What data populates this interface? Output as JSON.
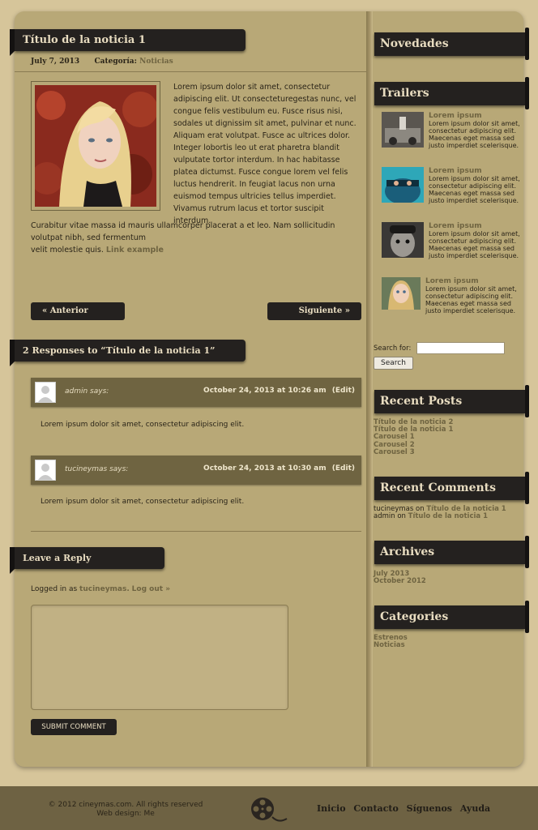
{
  "post": {
    "title": "Título de la noticia 1",
    "date": "July 7, 2013",
    "category_label": "Categoría:",
    "category_value": "Noticias",
    "body_1": "Lorem ipsum dolor sit amet, consectetur adipiscing elit. Ut consecteturegestas nunc, vel congue felis vestibulum eu. Fusce risus nisi, sodales ut dignissim sit amet, pulvinar et nunc. Aliquam erat volutpat. Fusce ac ultrices dolor. Integer lobortis leo ut erat pharetra blandit vulputate tortor interdum. In hac habitasse platea dictumst. Fusce congue lorem vel felis luctus hendrerit. In feugiat lacus non urna euismod tempus ultricies tellus imperdiet. Vivamus rutrum lacus et tortor suscipit interdum.",
    "body_2": "Curabitur vitae massa id mauris ullamcorper placerat a et leo. Nam sollicitudin volutpat nibh, sed fermentum",
    "body_3": "velit molestie quis.",
    "link_example": "Link example"
  },
  "nav": {
    "prev": "« Anterior",
    "next": "Siguiente »"
  },
  "responses": {
    "title": "2 Responses to “Título de la noticia 1”",
    "comments": [
      {
        "author": "admin says:",
        "date": "October 24, 2013 at 10:26 am",
        "edit": "(Edit)",
        "text": "Lorem ipsum dolor sit amet, consectetur adipiscing elit."
      },
      {
        "author": "tucineymas says:",
        "date": "October 24, 2013 at 10:30 am",
        "edit": "(Edit)",
        "text": "Lorem ipsum dolor sit amet, consectetur adipiscing elit."
      }
    ]
  },
  "reply": {
    "title": "Leave a Reply",
    "logged_prefix": "Logged in as",
    "logged_user": "tucineymas",
    "logout": "Log out »",
    "submit": "SUBMIT COMMENT"
  },
  "sidebar": {
    "novedades": "Novedades",
    "trailers_title": "Trailers",
    "trailers": [
      {
        "title": "Lorem ipsum",
        "text": "Lorem ipsum dolor sit amet, consectetur adipiscing elit. Maecenas eget massa sed justo imperdiet scelerisque."
      },
      {
        "title": "Lorem ipsum",
        "text": "Lorem ipsum dolor sit amet, consectetur adipiscing elit. Maecenas eget massa sed justo imperdiet scelerisque."
      },
      {
        "title": "Lorem ipsum",
        "text": "Lorem ipsum dolor sit amet, consectetur adipiscing elit. Maecenas eget massa sed justo imperdiet scelerisque."
      },
      {
        "title": "Lorem ipsum",
        "text": "Lorem ipsum dolor sit amet, consectetur adipiscing elit. Maecenas eget massa sed justo imperdiet scelerisque."
      }
    ],
    "search_label": "Search for:",
    "search_button": "Search",
    "recent_posts_title": "Recent Posts",
    "recent_posts": [
      "Título de la noticia 2",
      "Título de la noticia 1",
      "Carousel 1",
      "Carousel 2",
      "Carousel 3"
    ],
    "recent_comments_title": "Recent Comments",
    "recent_comments": [
      {
        "who": "tucineymas",
        "on": "on",
        "post": "Título de la noticia 1"
      },
      {
        "who": "admin",
        "on": "on",
        "post": "Título de la noticia 1"
      }
    ],
    "archives_title": "Archives",
    "archives": [
      "July 2013",
      "October 2012"
    ],
    "categories_title": "Categories",
    "categories": [
      "Estrenos",
      "Noticias"
    ]
  },
  "footer": {
    "copyright": "© 2012 cineymas.com. All rights reserved",
    "design": "Web design: Me",
    "nav": [
      "Inicio",
      "Contacto",
      "Síguenos",
      "Ayuda"
    ]
  }
}
